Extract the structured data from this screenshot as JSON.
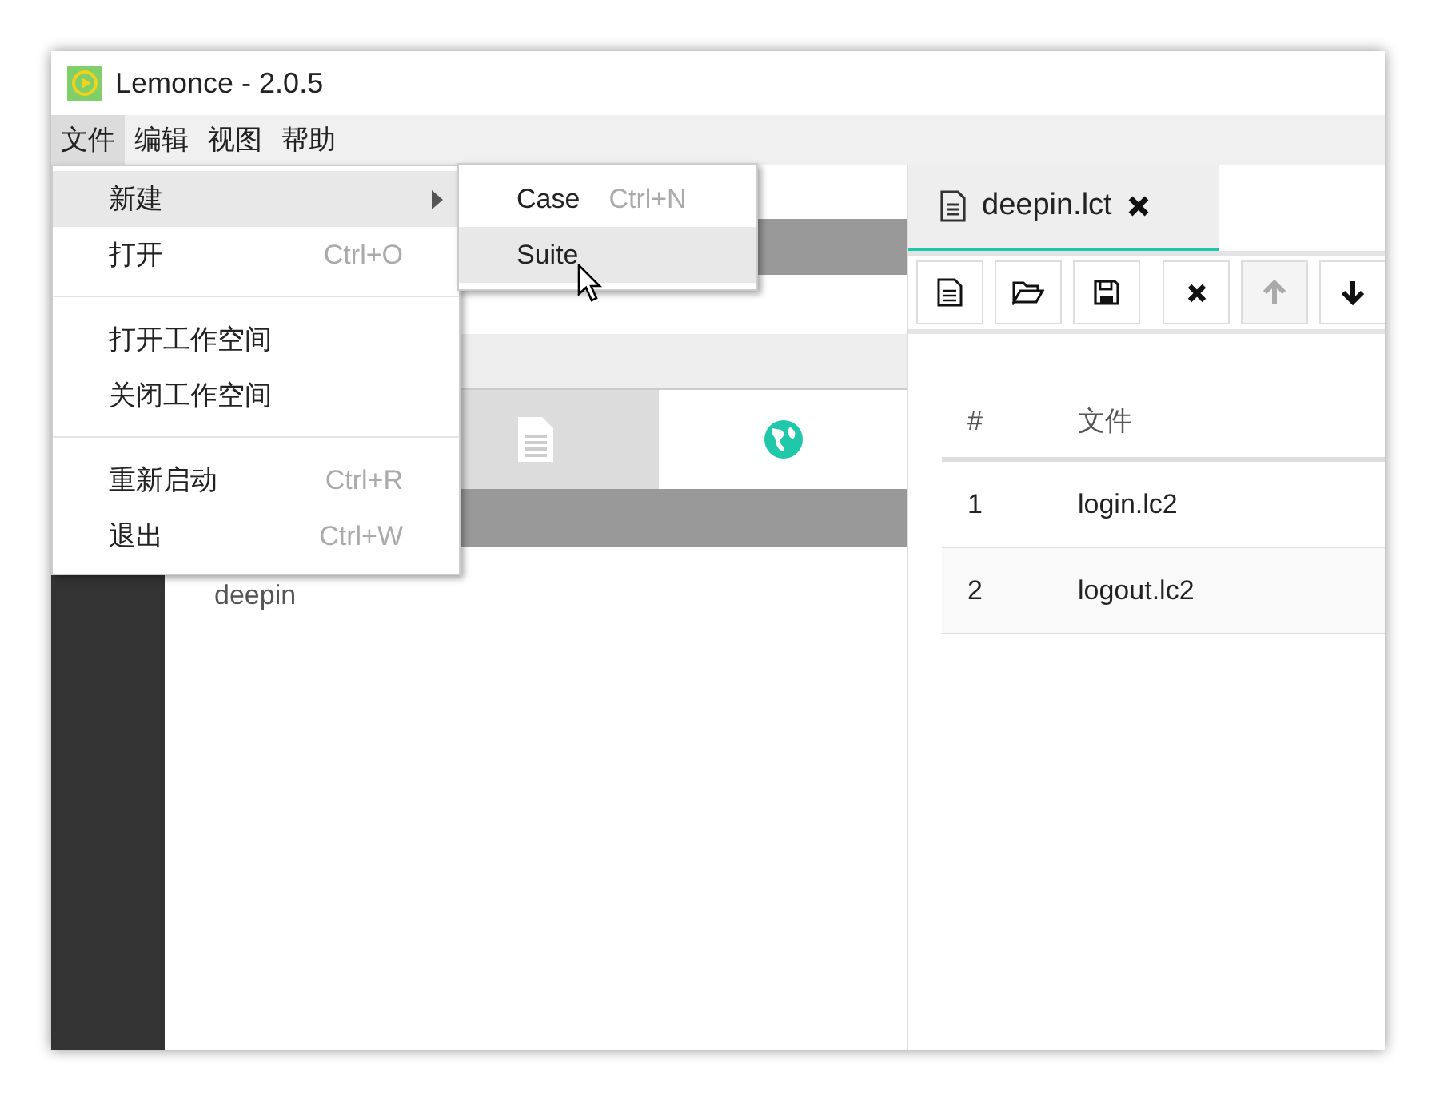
{
  "window": {
    "title": "Lemonce - 2.0.5"
  },
  "menubar": [
    {
      "label": "文件",
      "selected": true
    },
    {
      "label": "编辑",
      "selected": false
    },
    {
      "label": "视图",
      "selected": false
    },
    {
      "label": "帮助",
      "selected": false
    }
  ],
  "file_menu": [
    {
      "kind": "item",
      "label": "新建",
      "submenu": true,
      "selected": true
    },
    {
      "kind": "item",
      "label": "打开",
      "shortcut": "Ctrl+O",
      "submenu": false,
      "selected": false
    },
    {
      "kind": "separator"
    },
    {
      "kind": "item",
      "label": "打开工作空间",
      "submenu": false,
      "selected": false
    },
    {
      "kind": "item",
      "label": "关闭工作空间",
      "submenu": false,
      "selected": false
    },
    {
      "kind": "separator"
    },
    {
      "kind": "item",
      "label": "重新启动",
      "shortcut": "Ctrl+R",
      "submenu": false,
      "selected": false
    },
    {
      "kind": "item",
      "label": "退出",
      "shortcut": "Ctrl+W",
      "submenu": false,
      "selected": false
    }
  ],
  "new_submenu": [
    {
      "label": "Case",
      "shortcut": "Ctrl+N",
      "selected": false
    },
    {
      "label": "Suite",
      "selected": true
    }
  ],
  "left_panel": {
    "tabs": [
      {
        "kind": "file",
        "selected": false
      },
      {
        "kind": "globe",
        "selected": true
      }
    ],
    "tree": [
      {
        "label": "deepin"
      }
    ]
  },
  "editor": {
    "tab": {
      "label": "deepin.lct",
      "selected": true
    },
    "toolbar": [
      {
        "kind": "button",
        "disabled": false
      },
      {
        "kind": "button",
        "disabled": false
      },
      {
        "kind": "button",
        "disabled": false
      },
      {
        "kind": "separator"
      },
      {
        "kind": "button",
        "disabled": false
      },
      {
        "kind": "button",
        "disabled": true
      },
      {
        "kind": "button",
        "disabled": false
      }
    ],
    "table": {
      "columns": [
        "#",
        "文件"
      ],
      "rows": [
        [
          "1",
          "login.lc2"
        ],
        [
          "2",
          "logout.lc2"
        ]
      ]
    }
  }
}
